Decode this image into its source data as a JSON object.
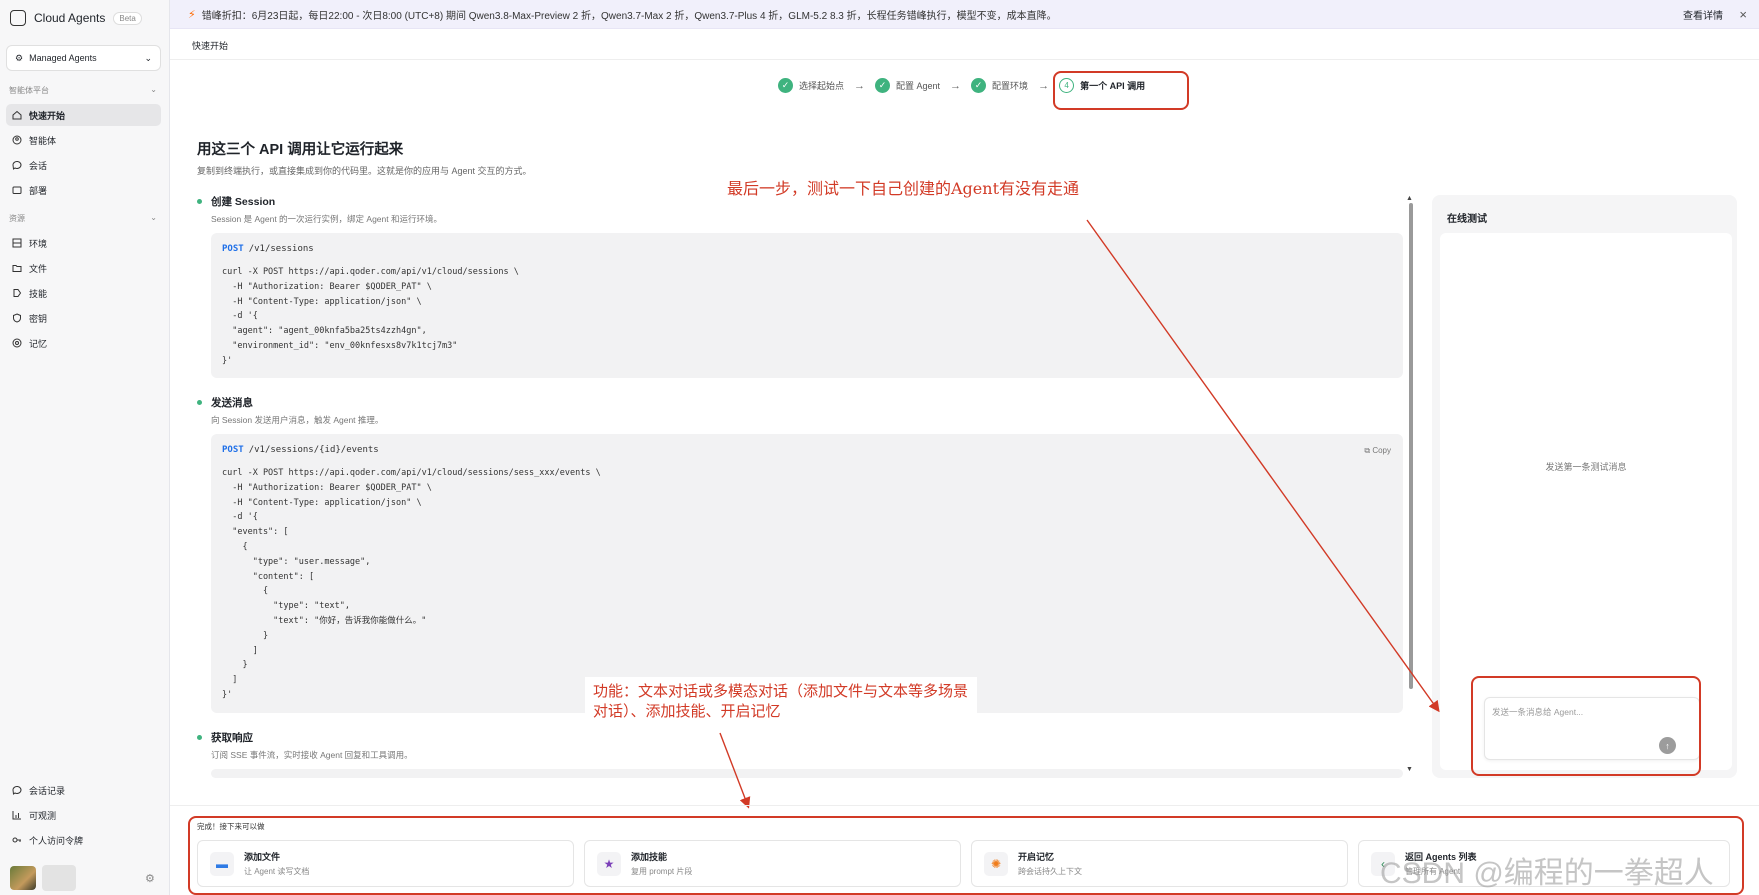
{
  "sidebar": {
    "brand": "Cloud Agents",
    "beta": "Beta",
    "workspace": "Managed Agents",
    "sections": {
      "platform": "智能体平台",
      "resources": "资源"
    },
    "nav_platform": [
      "快速开始",
      "智能体",
      "会话",
      "部署"
    ],
    "nav_resources": [
      "环境",
      "文件",
      "技能",
      "密钥",
      "记忆"
    ],
    "nav_footer": [
      "会话记录",
      "可观测",
      "个人访问令牌"
    ],
    "active": "快速开始"
  },
  "banner": {
    "text": "错峰折扣：6月23日起，每日22:00 - 次日8:00 (UTC+8) 期间 Qwen3.8-Max-Preview 2 折，Qwen3.7-Max 2 折，Qwen3.7-Plus 4 折，GLM-5.2 8.3 折，长程任务错峰执行，模型不变，成本直降。",
    "link": "查看详情"
  },
  "breadcrumb": "快速开始",
  "stepper": {
    "steps": [
      "选择起始点",
      "配置 Agent",
      "配置环境",
      "第一个 API 调用"
    ],
    "current_number": "4",
    "arrow": "→"
  },
  "main": {
    "title": "用这三个 API 调用让它运行起来",
    "subtitle": "复制到终端执行，或直接集成到你的代码里。这就是你的应用与 Agent 交互的方式。",
    "sections": [
      {
        "title": "创建 Session",
        "desc": "Session 是 Agent 的一次运行实例，绑定 Agent 和运行环境。",
        "method": "POST",
        "path": "/v1/sessions",
        "code": "curl -X POST https://api.qoder.com/api/v1/cloud/sessions \\\n  -H \"Authorization: Bearer $QODER_PAT\" \\\n  -H \"Content-Type: application/json\" \\\n  -d '{\n  \"agent\": \"agent_00knfa5ba25ts4zzh4gn\",\n  \"environment_id\": \"env_00knfesxs8v7k1tcj7m3\"\n}'"
      },
      {
        "title": "发送消息",
        "desc": "向 Session 发送用户消息，触发 Agent 推理。",
        "method": "POST",
        "path": "/v1/sessions/{id}/events",
        "copy": "Copy",
        "code": "curl -X POST https://api.qoder.com/api/v1/cloud/sessions/sess_xxx/events \\\n  -H \"Authorization: Bearer $QODER_PAT\" \\\n  -H \"Content-Type: application/json\" \\\n  -d '{\n  \"events\": [\n    {\n      \"type\": \"user.message\",\n      \"content\": [\n        {\n          \"type\": \"text\",\n          \"text\": \"你好，告诉我你能做什么。\"\n        }\n      ]\n    }\n  ]\n}'"
      },
      {
        "title": "获取响应",
        "desc": "订阅 SSE 事件流，实时接收 Agent 回复和工具调用。"
      }
    ]
  },
  "test_panel": {
    "title": "在线测试",
    "empty": "发送第一条测试消息",
    "placeholder": "发送一条消息给 Agent..."
  },
  "annotations": {
    "a1": "最后一步，测试一下自己创建的Agent有没有走通",
    "a2": "功能：文本对话或多模态对话（添加文件与文本等多场景对话）、添加技能、开启记忆"
  },
  "next": {
    "label": "完成！接下来可以做",
    "cards": [
      {
        "title": "添加文件",
        "sub": "让 Agent 读写文档",
        "icon": "folder-icon"
      },
      {
        "title": "添加技能",
        "sub": "复用 prompt 片段",
        "icon": "star-icon"
      },
      {
        "title": "开启记忆",
        "sub": "跨会话持久上下文",
        "icon": "brain-icon"
      },
      {
        "title": "返回 Agents 列表",
        "sub": "管理所有 Agent",
        "icon": "back-icon"
      }
    ]
  },
  "watermark": "CSDN @编程的一拳超人",
  "colors": {
    "accent_green": "#3fb37f",
    "annotation_red": "#d23a26",
    "method_blue": "#1e6fe8"
  }
}
